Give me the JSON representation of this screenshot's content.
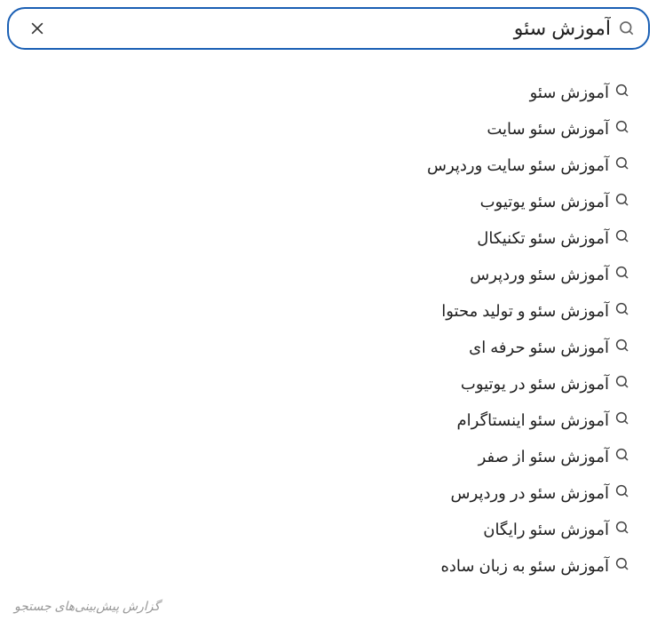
{
  "search": {
    "query": "آموزش سئو",
    "placeholder": ""
  },
  "suggestions": [
    {
      "text": "آموزش سئو"
    },
    {
      "text": "آموزش سئو سایت"
    },
    {
      "text": "آموزش سئو سایت وردپرس"
    },
    {
      "text": "آموزش سئو یوتیوب"
    },
    {
      "text": "آموزش سئو تکنیکال"
    },
    {
      "text": "آموزش سئو وردپرس"
    },
    {
      "text": "آموزش سئو و تولید محتوا"
    },
    {
      "text": "آموزش سئو حرفه ای"
    },
    {
      "text": "آموزش سئو در یوتیوب"
    },
    {
      "text": "آموزش سئو اینستاگرام"
    },
    {
      "text": "آموزش سئو از صفر"
    },
    {
      "text": "آموزش سئو در وردپرس"
    },
    {
      "text": "آموزش سئو رایگان"
    },
    {
      "text": "آموزش سئو به زبان ساده"
    }
  ],
  "footer": {
    "report_label": "گزارش پیش‌بینی‌های جستجو"
  }
}
